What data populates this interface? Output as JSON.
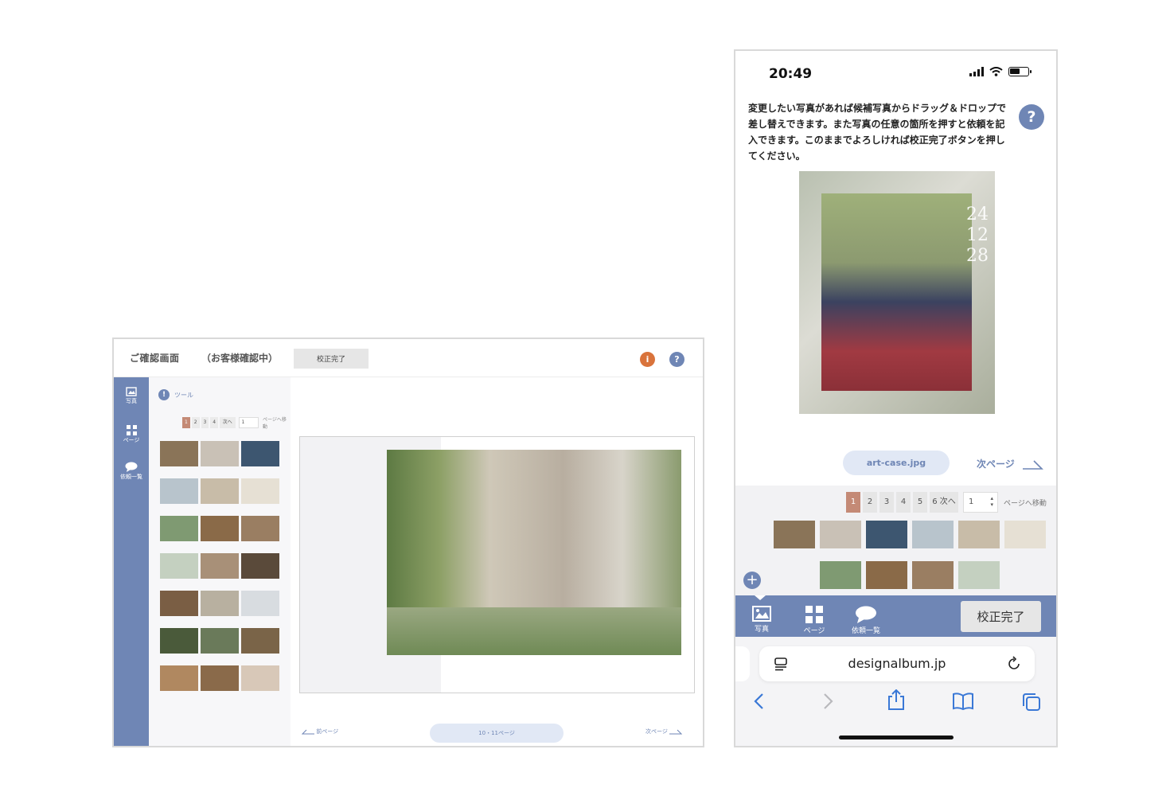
{
  "desktop": {
    "title": "ご確認画面",
    "status": "（お客様確認中）",
    "done_button": "校正完了",
    "info_glyph": "i",
    "help_glyph": "?",
    "rail": [
      {
        "label": "写真",
        "icon": "photo-icon"
      },
      {
        "label": "ページ",
        "icon": "grid-icon"
      },
      {
        "label": "依頼一覧",
        "icon": "speech-bubble-icon"
      }
    ],
    "tool_glyph": "!",
    "tool_label": "ツール",
    "pagination": {
      "pages": [
        "1",
        "2",
        "3",
        "4"
      ],
      "active": "1",
      "next": "次へ",
      "select": "1",
      "move": "ページへ移動"
    },
    "thumb_colors": [
      "#8a7458",
      "#c9c1b6",
      "#3d5670",
      "#b8c4cc",
      "#c8bca8",
      "#e6e0d4",
      "#7f9a72",
      "#8a6a48",
      "#9a7e62",
      "#c4d0c0",
      "#a89078",
      "#5a4a3a",
      "#7a5e44",
      "#b8b0a0",
      "#d8dce0",
      "#4a5a3a",
      "#6a7a5a",
      "#7a6448",
      "#b08860",
      "#8a6a4a",
      "#d8c8b8"
    ],
    "prev_label": "前ページ",
    "page_label": "10・11ページ",
    "next_label": "次ページ"
  },
  "phone": {
    "time": "20:49",
    "instruction": "変更したい写真があれば候補写真からドラッグ＆ドロップで差し替えできます。また写真の任意の箇所を押すと依頼を記入できます。このままでよろしければ校正完了ボタンを押してください。",
    "help_glyph": "?",
    "date_overlay": [
      "24",
      "12",
      "28"
    ],
    "file_name": "art-case.jpg",
    "next_page": "次ページ",
    "pagination": {
      "pages": [
        "1",
        "2",
        "3",
        "4",
        "5"
      ],
      "active": "1",
      "next": "6 次へ",
      "select": "1",
      "move": "ページへ移動"
    },
    "thumb_colors_row1": [
      "#8a7458",
      "#c9c1b6",
      "#3d5670",
      "#b8c4cc",
      "#c8bca8",
      "#e6e0d4"
    ],
    "thumb_colors_row2": [
      "#7f9a72",
      "#8a6a48",
      "#9a7e62",
      "#c4d0c0"
    ],
    "add_glyph": "+",
    "tabs": [
      {
        "label": "写真",
        "icon": "photo-icon"
      },
      {
        "label": "ページ",
        "icon": "grid-icon"
      },
      {
        "label": "依頼一覧",
        "icon": "speech-bubble-icon"
      }
    ],
    "done_button": "校正完了",
    "url": "designalbum.jp"
  },
  "colors": {
    "accent": "#6f86b5",
    "active_page": "#c48a76",
    "info": "#d9733b"
  }
}
